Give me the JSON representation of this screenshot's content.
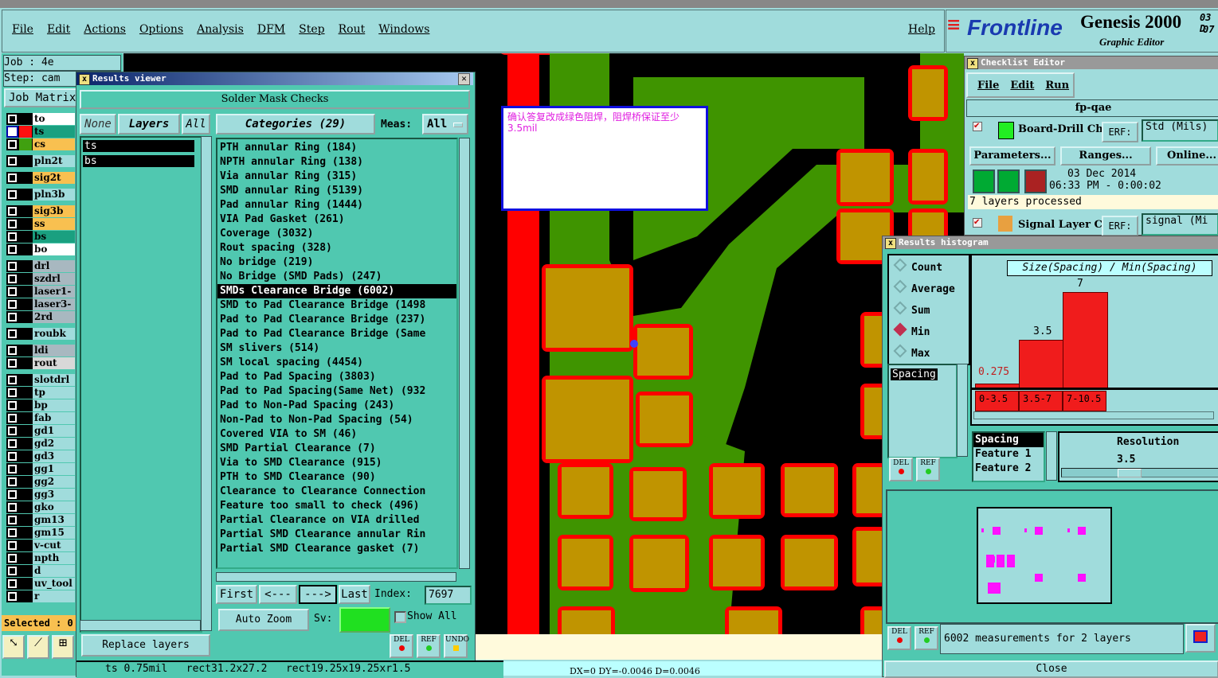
{
  "menubar": {
    "items": [
      "File",
      "Edit",
      "Actions",
      "Options",
      "Analysis",
      "DFM",
      "Step",
      "Rout",
      "Windows"
    ],
    "help": "Help"
  },
  "brand": {
    "logo": "Frontline",
    "product": "Genesis 2000",
    "subtitle": "Graphic Editor",
    "date_fragment": "03 D",
    "time_fragment": "07"
  },
  "job": {
    "job": "Job : 4e",
    "step": "Step: cam",
    "matrix_button": "Job Matrix"
  },
  "layers": [
    {
      "name": "to",
      "color": "#ffffff",
      "swatch": ""
    },
    {
      "name": "ts",
      "color": "#1aa080",
      "swatch": "#ff1010"
    },
    {
      "name": "cs",
      "color": "#f8c050",
      "swatch": "#40a010"
    },
    {
      "name": "pln2t",
      "color": "#a0dcdc"
    },
    {
      "name": "sig2t",
      "color": "#f8c050"
    },
    {
      "name": "pln3b",
      "color": "#a0dcdc"
    },
    {
      "name": "sig3b",
      "color": "#f8c050"
    },
    {
      "name": "ss",
      "color": "#f8c050"
    },
    {
      "name": "bs",
      "color": "#1aa080"
    },
    {
      "name": "bo",
      "color": "#ffffff"
    },
    {
      "name": "drl",
      "color": "#a8b8c0"
    },
    {
      "name": "szdrl",
      "color": "#a8b8c0"
    },
    {
      "name": "laser1-",
      "color": "#a8b8c0"
    },
    {
      "name": "laser3-",
      "color": "#a8b8c0"
    },
    {
      "name": "2rd",
      "color": "#a8b8c0"
    },
    {
      "name": "roubk",
      "color": "#a0dcdc"
    },
    {
      "name": "ldi",
      "color": "#a8b8c0"
    },
    {
      "name": "rout",
      "color": "#d8d8d8"
    },
    {
      "name": "slotdrl",
      "color": "#a0dcdc"
    },
    {
      "name": "tp",
      "color": "#a0dcdc"
    },
    {
      "name": "bp",
      "color": "#a0dcdc"
    },
    {
      "name": "fab",
      "color": "#a0dcdc"
    },
    {
      "name": "gd1",
      "color": "#a0dcdc"
    },
    {
      "name": "gd2",
      "color": "#a0dcdc"
    },
    {
      "name": "gd3",
      "color": "#a0dcdc"
    },
    {
      "name": "gg1",
      "color": "#a0dcdc"
    },
    {
      "name": "gg2",
      "color": "#a0dcdc"
    },
    {
      "name": "gg3",
      "color": "#a0dcdc"
    },
    {
      "name": "gko",
      "color": "#a0dcdc"
    },
    {
      "name": "gm13",
      "color": "#a0dcdc"
    },
    {
      "name": "gm15",
      "color": "#a0dcdc"
    },
    {
      "name": "v-cut",
      "color": "#a0dcdc"
    },
    {
      "name": "npth",
      "color": "#a0dcdc"
    },
    {
      "name": "d",
      "color": "#a0dcdc"
    },
    {
      "name": "uv_tool",
      "color": "#a0dcdc"
    },
    {
      "name": "r",
      "color": "#a0dcdc"
    }
  ],
  "selected": "Selected : 0",
  "results_viewer": {
    "title": "Results viewer",
    "header": "Solder Mask Checks",
    "none": "None",
    "layers": "Layers",
    "all": "All",
    "layer_list": [
      "ts",
      "bs"
    ],
    "categories_label": "Categories (29)",
    "meas_label": "Meas:",
    "meas_value": "All",
    "categories": [
      "PTH annular Ring (184)",
      "NPTH annular Ring (138)",
      "Via annular Ring (315)",
      "SMD annular Ring (5139)",
      "Pad annular Ring (1444)",
      "VIA Pad Gasket (261)",
      "Coverage (3032)",
      "Rout spacing (328)",
      "No bridge (219)",
      "No Bridge (SMD Pads) (247)",
      "SMDs Clearance Bridge (6002)",
      "SMD to Pad Clearance Bridge (1498",
      "Pad to Pad Clearance Bridge (237)",
      "Pad to Pad Clearance Bridge (Same",
      "SM slivers (514)",
      "SM local spacing (4454)",
      "Pad to Pad Spacing (3803)",
      "Pad to Pad Spacing(Same Net) (932",
      "Pad to Non-Pad Spacing (243)",
      "Non-Pad to Non-Pad Spacing (54)",
      "Covered VIA to SM (46)",
      "SMD Partial Clearance (7)",
      "Via to SMD Clearance (915)",
      "PTH to SMD Clearance (90)",
      "Clearance to Clearance Connection",
      "Feature too small to check (496)",
      "Partial Clearance on VIA drilled",
      "Partial SMD Clearance annular Rin",
      "Partial SMD Clearance gasket (7)"
    ],
    "selected_index": 10,
    "first": "First",
    "prev": "<---",
    "next": "--->",
    "last": "Last",
    "index_label": "Index:",
    "index_value": "7697",
    "auto_zoom": "Auto Zoom",
    "sv_label": "Sv:",
    "show_all": "Show All",
    "replace_layers": "Replace layers",
    "del": "DEL",
    "ref": "REF",
    "undo": "UNDO",
    "status": "ts 0.75mil   rect31.2x27.2   rect19.25x19.25xr1.5"
  },
  "note": {
    "text": "确认答复改成绿色阻焊，阻焊桥保证至少3.5mil"
  },
  "canvas_status": "DX=0 DY=-0.0046 D=0.0046",
  "checklist": {
    "title": "Checklist Editor",
    "menu": [
      "File",
      "Edit",
      "Run"
    ],
    "name": "fp-qae",
    "items": [
      {
        "name": "Board-Drill Che",
        "erf": "ERF:",
        "erf_value": "Std (Mils)"
      },
      {
        "name": "Signal Layer Ch",
        "erf": "ERF:",
        "erf_value": "signal (Mi"
      }
    ],
    "parameters": "Parameters...",
    "ranges": "Ranges...",
    "online": "Online...",
    "date": "03 Dec 2014",
    "time": "06:33 PM - 0:00:02",
    "processed": "7 layers processed"
  },
  "histogram": {
    "title": "Results histogram",
    "modes": [
      "Count",
      "Average",
      "Sum",
      "Min",
      "Max"
    ],
    "selected_mode": "Min",
    "attr_list": [
      "Spacing"
    ],
    "attr_list2": [
      "Spacing",
      "Feature 1",
      "Feature 2"
    ],
    "resolution_label": "Resolution",
    "resolution_value": "3.5",
    "summary": "6002 measurements for 2 layers",
    "close": "Close",
    "del": "DEL",
    "ref": "REF"
  },
  "chart_data": {
    "type": "bar",
    "title": "Size(Spacing) / Min(Spacing)",
    "categories": [
      "0-3.5",
      "3.5-7",
      "7-10.5"
    ],
    "values": [
      0.275,
      3.5,
      7
    ],
    "value_labels": [
      "0.275",
      "3.5",
      "7"
    ],
    "ylim": [
      0,
      7
    ]
  }
}
